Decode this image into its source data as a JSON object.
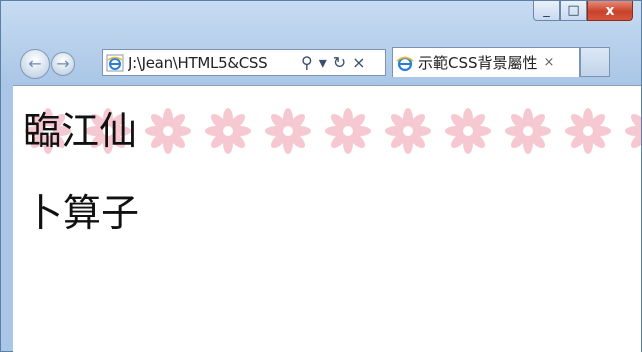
{
  "window": {
    "controls": {
      "minimize_icon": "minimize-icon",
      "maximize_icon": "maximize-icon",
      "close_icon": "close-icon",
      "minimize_glyph": "_",
      "maximize_glyph": "□",
      "close_glyph": "x"
    }
  },
  "toolbar": {
    "back_icon": "back-arrow-icon",
    "forward_icon": "forward-arrow-icon",
    "back_glyph": "←",
    "forward_glyph": "→",
    "address": {
      "url": "J:\\Jean\\HTML5&CSS",
      "search_icon": "search-icon",
      "search_glyph": "⚲",
      "dropdown_glyph": "▾",
      "refresh_glyph": "↻",
      "stop_glyph": "×"
    }
  },
  "tabs": [
    {
      "label": "示範CSS背景屬性",
      "close_glyph": "×"
    }
  ],
  "content": {
    "background_pattern": "pink-flower-icon",
    "flower_color": "#f6c9d2",
    "headings": [
      "臨江仙",
      "卜算子"
    ]
  },
  "colors": {
    "frame": "#b9d1ec",
    "close_button": "#c8432b",
    "ie_blue": "#2a7fd4"
  }
}
